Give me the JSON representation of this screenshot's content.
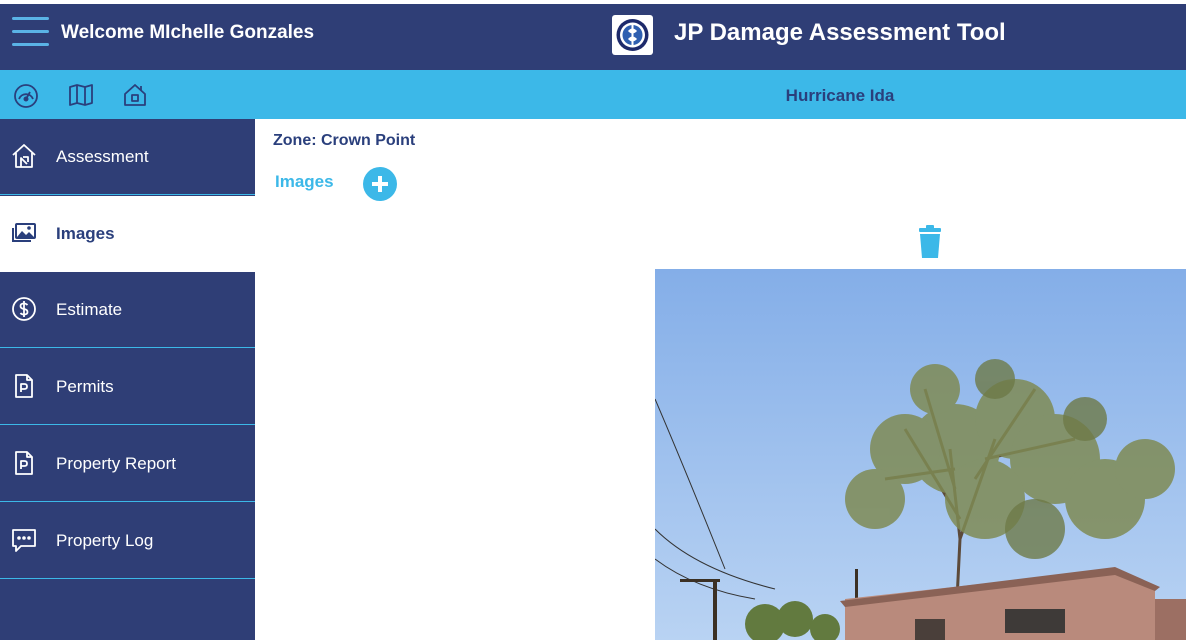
{
  "header": {
    "welcome_text": "Welcome MIchelle Gonzales",
    "app_title": "JP Damage Assessment Tool",
    "menu_icon": "hamburger-menu-icon",
    "logo": "jefferson-parish-seal-logo"
  },
  "subheader": {
    "event_title": "Hurricane Ida",
    "icons": [
      "dashboard-gauge-icon",
      "map-icon",
      "home-icon"
    ]
  },
  "sidebar": {
    "items": [
      {
        "label": "Assessment",
        "icon": "house-icon",
        "active": false
      },
      {
        "label": "Images",
        "icon": "image-gallery-icon",
        "active": true
      },
      {
        "label": "Estimate",
        "icon": "dollar-circle-icon",
        "active": false
      },
      {
        "label": "Permits",
        "icon": "permit-document-icon",
        "active": false
      },
      {
        "label": "Property Report",
        "icon": "report-document-icon",
        "active": false
      },
      {
        "label": "Property Log",
        "icon": "chat-log-icon",
        "active": false
      }
    ]
  },
  "main": {
    "zone_label": "Zone: Crown Point",
    "images_heading": "Images",
    "add_icon": "plus-circle-icon",
    "delete_icon": "trash-icon"
  },
  "colors": {
    "navy": "#2f3e76",
    "light_blue": "#3cb8e8",
    "text_navy": "#2a3f7c"
  }
}
